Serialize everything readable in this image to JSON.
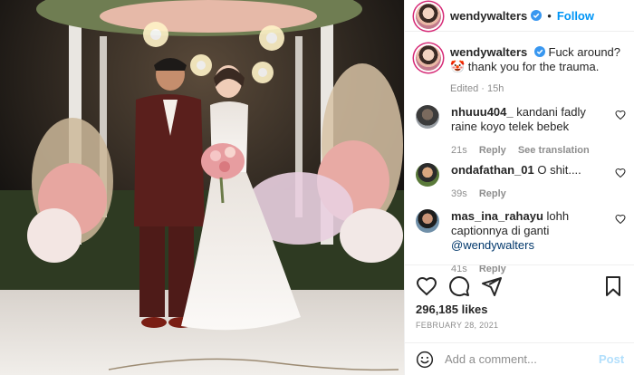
{
  "post": {
    "username": "wendywalters",
    "follow_label": "Follow",
    "separator": "•",
    "caption_text": "Fuck around? 🤡 thank you for the trauma.",
    "caption_meta": "Edited · 15h"
  },
  "comments": [
    {
      "username": "nhuuu404_",
      "text": "kandani fadly raine koyo telek bebek",
      "time": "21s",
      "reply_label": "Reply",
      "translate_label": "See translation"
    },
    {
      "username": "ondafathan_01",
      "text": "O shit....",
      "time": "39s",
      "reply_label": "Reply"
    },
    {
      "username": "mas_ina_rahayu",
      "text": "lohh captionnya di ganti",
      "mention": "@wendywalters",
      "time": "41s",
      "reply_label": "Reply"
    }
  ],
  "stats": {
    "likes": "296,185 likes",
    "date": "FEBRUARY 28, 2021"
  },
  "composer": {
    "placeholder": "Add a comment...",
    "post_label": "Post"
  },
  "colors": {
    "accent": "#0095f6",
    "verified": "#3897f0",
    "muted": "#8e8e8e",
    "post_disabled": "#b2dffc"
  },
  "icons": [
    "verified-badge-icon",
    "heart-icon",
    "comment-icon",
    "share-icon",
    "bookmark-icon",
    "emoji-icon"
  ]
}
